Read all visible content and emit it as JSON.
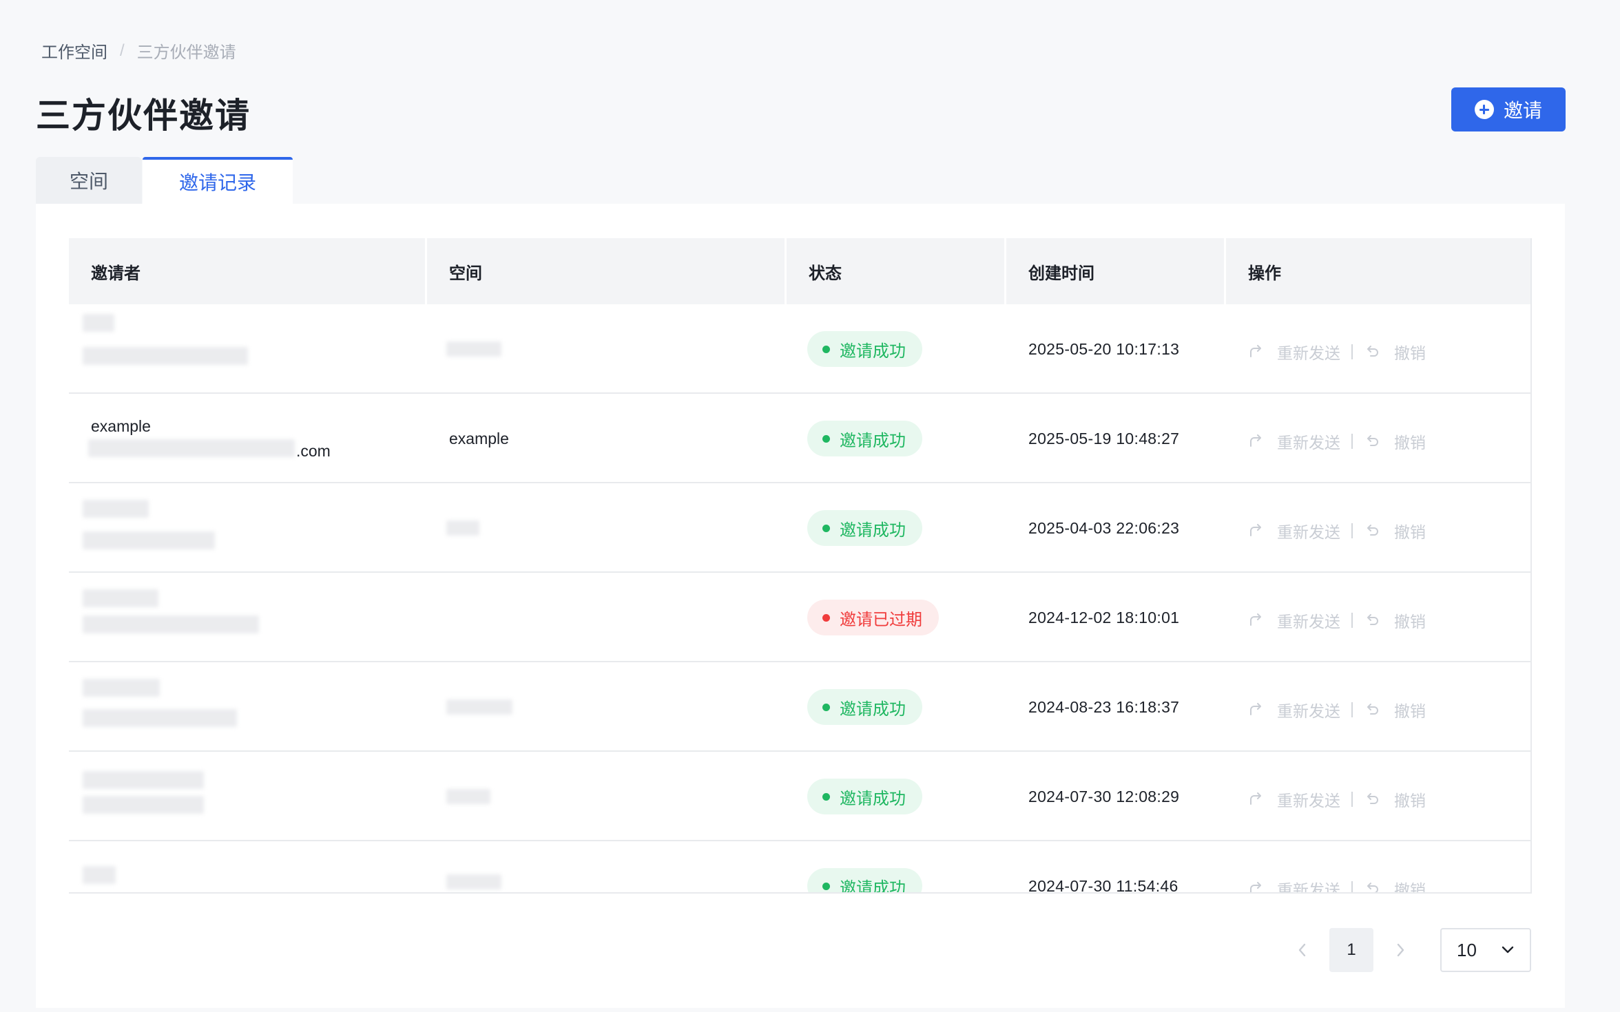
{
  "breadcrumb": {
    "root": "工作空间",
    "separator": "/",
    "current": "三方伙伴邀请"
  },
  "page": {
    "title": "三方伙伴邀请"
  },
  "toolbar": {
    "invite_label": "邀请"
  },
  "tabs": [
    {
      "label": "空间",
      "active": false
    },
    {
      "label": "邀请记录",
      "active": true
    }
  ],
  "table": {
    "headers": [
      "邀请者",
      "空间",
      "状态",
      "创建时间",
      "操作"
    ],
    "rows": [
      {
        "inviter_name": "",
        "inviter_email": "",
        "space": "",
        "status": "邀请成功",
        "status_type": "success",
        "created": "2025-05-20 10:17:13"
      },
      {
        "inviter_name": "example",
        "inviter_email": ".com",
        "space": "example",
        "status": "邀请成功",
        "status_type": "success",
        "created": "2025-05-19 10:48:27"
      },
      {
        "inviter_name": "",
        "inviter_email": "",
        "space": "",
        "status": "邀请成功",
        "status_type": "success",
        "created": "2025-04-03 22:06:23"
      },
      {
        "inviter_name": "",
        "inviter_email": "",
        "space": "",
        "status": "邀请已过期",
        "status_type": "expired",
        "created": "2024-12-02 18:10:01"
      },
      {
        "inviter_name": "",
        "inviter_email": "",
        "space": "",
        "status": "邀请成功",
        "status_type": "success",
        "created": "2024-08-23 16:18:37"
      },
      {
        "inviter_name": "",
        "inviter_email": "",
        "space": "",
        "status": "邀请成功",
        "status_type": "success",
        "created": "2024-07-30 12:08:29"
      },
      {
        "inviter_name": "",
        "inviter_email": "",
        "space": "",
        "status": "邀请成功",
        "status_type": "success",
        "created": "2024-07-30 11:54:46"
      }
    ],
    "actions": {
      "resend": "重新发送",
      "revoke": "撤销"
    }
  },
  "pagination": {
    "current_page": "1",
    "page_size": "10"
  },
  "colors": {
    "primary": "#2f67ea",
    "success": "#1fb761",
    "danger": "#f03c3c"
  }
}
